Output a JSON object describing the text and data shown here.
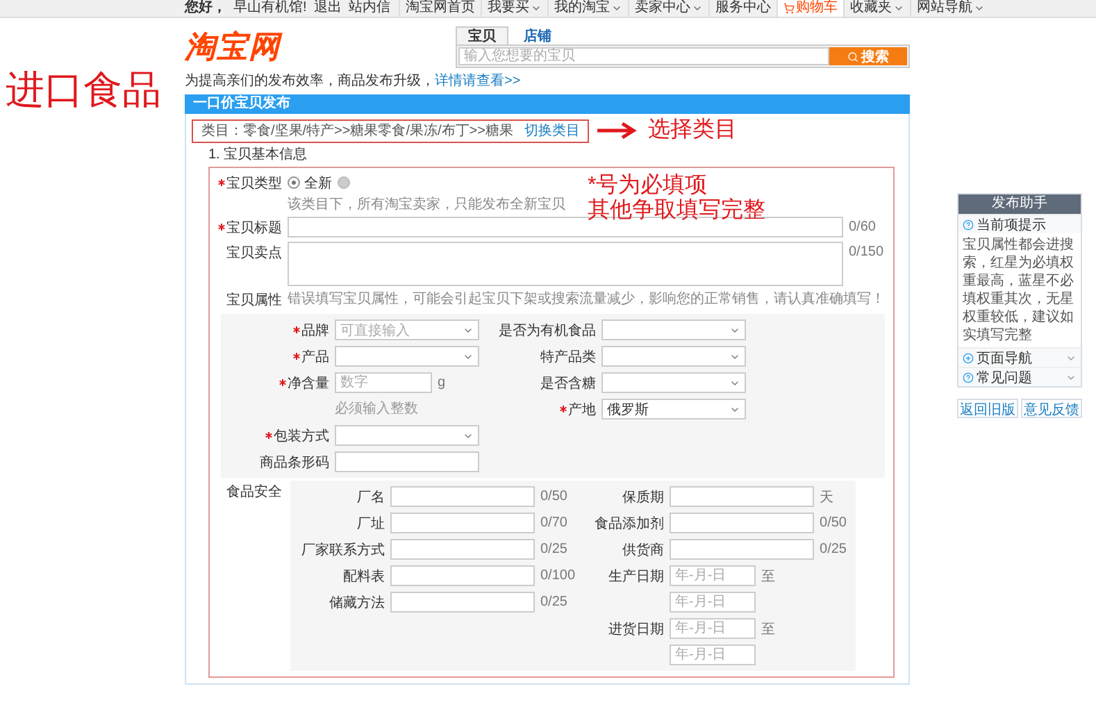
{
  "top_bar": {
    "greeting": "您好，",
    "user": "早山有机馆!",
    "links": [
      "退出",
      "站内信"
    ],
    "nav": [
      {
        "label": "淘宝网首页",
        "dropdown": false,
        "highlighted": false
      },
      {
        "label": "我要买",
        "dropdown": true,
        "highlighted": false
      },
      {
        "label": "我的淘宝",
        "dropdown": true,
        "highlighted": false
      },
      {
        "label": "卖家中心",
        "dropdown": true,
        "highlighted": false
      },
      {
        "label": "服务中心",
        "dropdown": false,
        "highlighted": false
      },
      {
        "label": "购物车",
        "dropdown": false,
        "highlighted": true
      },
      {
        "label": "收藏夹",
        "dropdown": true,
        "highlighted": false
      },
      {
        "label": "网站导航",
        "dropdown": true,
        "highlighted": false
      }
    ]
  },
  "side_note": "进口食品",
  "logo": "淘宝网",
  "search": {
    "tabs": [
      {
        "label": "宝贝",
        "selected": true
      },
      {
        "label": "店铺",
        "selected": false
      }
    ],
    "placeholder": "输入您想要的宝贝",
    "button": "搜索"
  },
  "notice": {
    "text": "为提高亲们的发布效率，商品发布升级，",
    "link": "详情请查看>>"
  },
  "section_title": "一口价宝贝发布",
  "category": {
    "label": "类目：零食/坚果/特产>>糖果零食/果冻/布丁>>糖果",
    "link": "切换类目",
    "note": "选择类目"
  },
  "step_title": "1. 宝贝基本信息",
  "form_note": [
    "*号为必填项",
    "其他争取填写完整"
  ],
  "item_type": {
    "label": "宝贝类型",
    "required": true,
    "options": [
      {
        "label": "全新",
        "selected": true,
        "disabled": false
      },
      {
        "selected": false,
        "disabled": true
      }
    ],
    "hint": "该类目下，所有淘宝卖家，只能发布全新宝贝"
  },
  "title_field": {
    "label": "宝贝标题",
    "required": true,
    "counter": "0/60"
  },
  "selling_points": {
    "label": "宝贝卖点",
    "counter": "0/150"
  },
  "attributes": {
    "label": "宝贝属性",
    "warning": "错误填写宝贝属性，可能会引起宝贝下架或搜索流量减少，影响您的正常销售，请认真准确填写！",
    "left": [
      {
        "label": "品牌",
        "required": true,
        "kind": "select",
        "placeholder": "可直接输入"
      },
      {
        "label": "产品",
        "required": true,
        "kind": "select"
      },
      {
        "label": "净含量",
        "required": true,
        "kind": "number",
        "placeholder": "数字",
        "unit": "g",
        "hint": "必须输入整数"
      },
      {
        "label": "包装方式",
        "required": true,
        "kind": "select"
      },
      {
        "label": "商品条形码",
        "kind": "text"
      }
    ],
    "right": [
      {
        "label": "是否为有机食品",
        "kind": "select"
      },
      {
        "label": "特产品类",
        "kind": "select"
      },
      {
        "label": "是否含糖",
        "kind": "select"
      },
      {
        "label": "产地",
        "required": true,
        "kind": "select",
        "value": "俄罗斯"
      }
    ]
  },
  "food_safety": {
    "label": "食品安全",
    "left": [
      {
        "label": "厂名",
        "kind": "text",
        "counter": "0/50"
      },
      {
        "label": "厂址",
        "kind": "text",
        "counter": "0/70"
      },
      {
        "label": "厂家联系方式",
        "kind": "text",
        "counter": "0/25"
      },
      {
        "label": "配料表",
        "kind": "text",
        "counter": "0/100"
      },
      {
        "label": "储藏方法",
        "kind": "text",
        "counter": "0/25"
      }
    ],
    "right": [
      {
        "label": "保质期",
        "kind": "text",
        "suffix": "天"
      },
      {
        "label": "食品添加剂",
        "kind": "text",
        "counter": "0/50"
      },
      {
        "label": "供货商",
        "kind": "text",
        "counter": "0/25"
      },
      {
        "label": "生产日期",
        "kind": "date_range",
        "placeholders": [
          "年-月-日",
          "年-月-日"
        ],
        "separator": "至"
      },
      {
        "label": "进货日期",
        "kind": "date_range",
        "placeholders": [
          "年-月-日",
          "年-月-日"
        ],
        "separator": "至"
      }
    ]
  },
  "helper": {
    "title": "发布助手",
    "sections": [
      {
        "label": "当前项提示",
        "expanded": true,
        "kind": "help",
        "text": "宝贝属性都会进搜索，红星为必填权重最高，蓝星不必填权重其次，无星权重较低，建议如实填写完整"
      },
      {
        "label": "页面导航",
        "expanded": false,
        "kind": "nav"
      },
      {
        "label": "常见问题",
        "expanded": false,
        "kind": "help"
      }
    ],
    "buttons": [
      "返回旧版",
      "意见反馈"
    ]
  }
}
